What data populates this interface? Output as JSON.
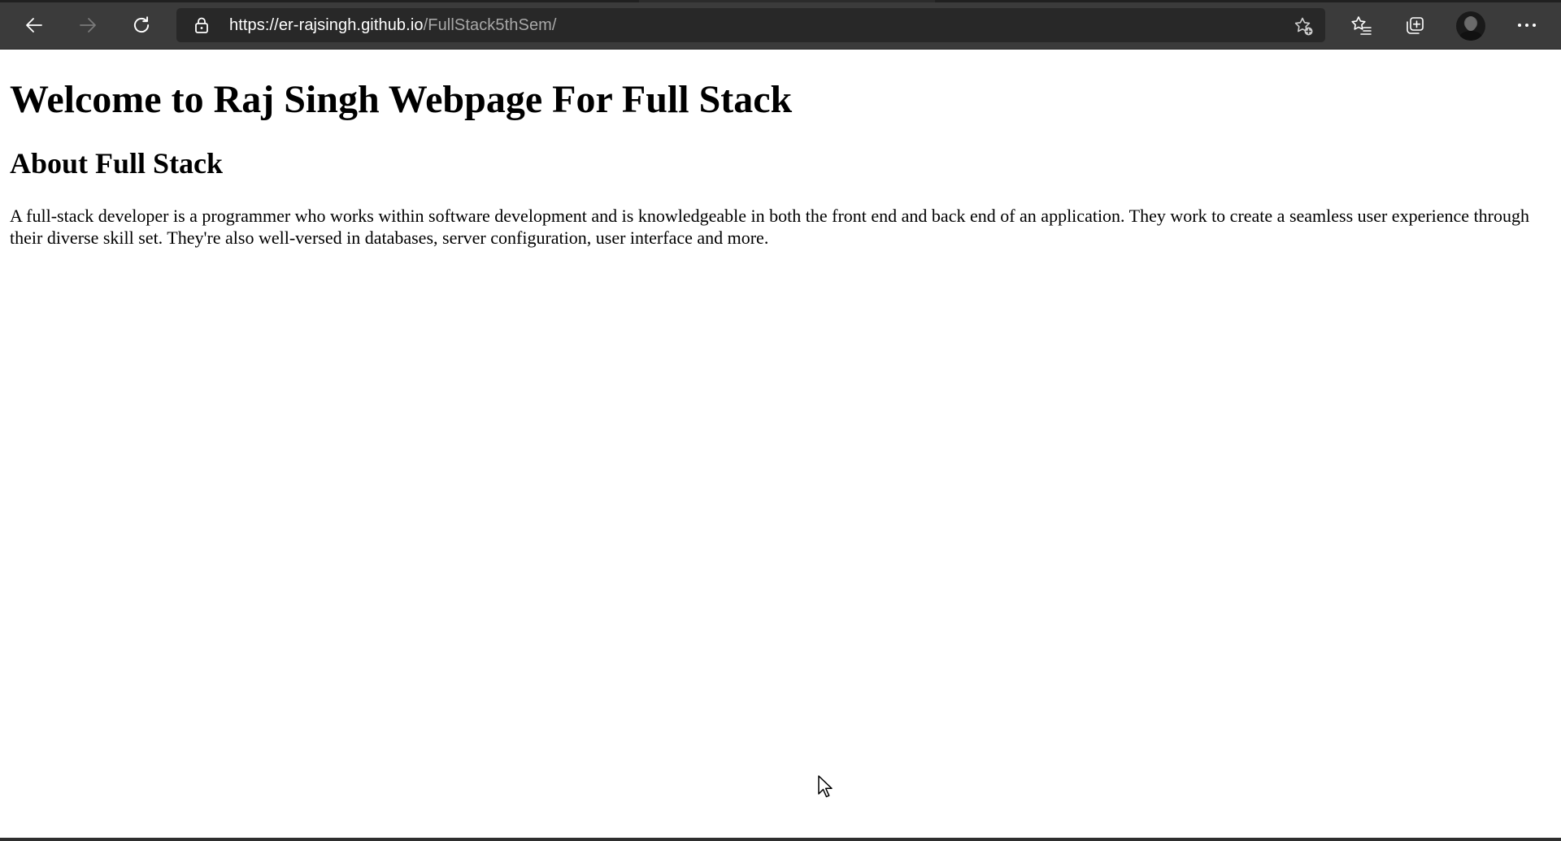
{
  "browser": {
    "url_host": "https://er-rajsingh.github.io",
    "url_path": "/FullStack5thSem/",
    "icons": {
      "back": "back-arrow-icon",
      "forward": "forward-arrow-icon",
      "refresh": "refresh-icon",
      "lock": "lock-icon",
      "add_favorite": "star-plus-icon",
      "favorites": "favorites-list-icon",
      "collections": "collections-icon",
      "profile": "profile-avatar",
      "more": "more-dots-icon"
    },
    "colors": {
      "toolbar_bg": "#3b3b3b",
      "address_bg": "#282828",
      "url_host": "#ffffff",
      "url_path": "#a8a8a8"
    }
  },
  "page": {
    "heading": "Welcome to Raj Singh Webpage For Full Stack",
    "subheading": "About Full Stack",
    "paragraph": "A full-stack developer is a programmer who works within software development and is knowledgeable in both the front end and back end of an application. They work to create a seamless user experience through their diverse skill set. They're also well-versed in databases, server configuration, user interface and more."
  }
}
